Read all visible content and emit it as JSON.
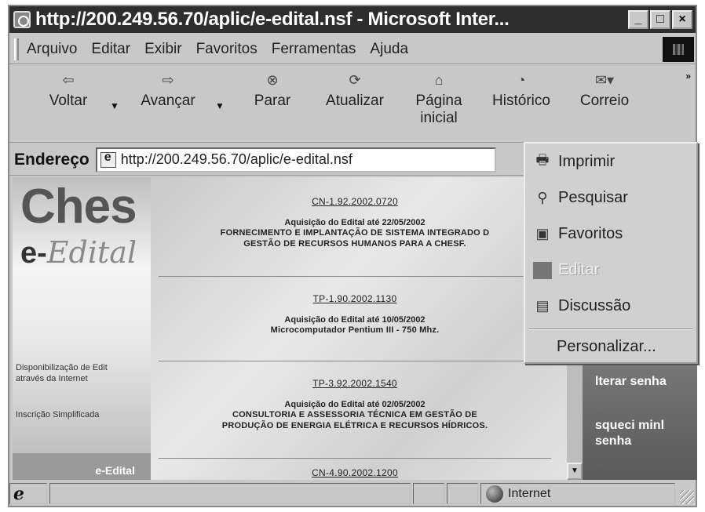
{
  "window": {
    "title": "http://200.249.56.70/aplic/e-edital.nsf - Microsoft Inter...",
    "minimize": "_",
    "maximize": "□",
    "close": "×"
  },
  "menubar": {
    "items": [
      "Arquivo",
      "Editar",
      "Exibir",
      "Favoritos",
      "Ferramentas",
      "Ajuda"
    ]
  },
  "toolbar": {
    "back": "Voltar",
    "forward": "Avançar",
    "stop": "Parar",
    "refresh": "Atualizar",
    "home_line1": "Página",
    "home_line2": "inicial",
    "history": "Histórico",
    "mail": "Correio",
    "more": "»"
  },
  "addressbar": {
    "label": "Endereço",
    "url": "http://200.249.56.70/aplic/e-edital.nsf"
  },
  "page": {
    "logo_top": "Ches",
    "logo_e": "e-",
    "logo_edital": "Edital",
    "left_links": [
      "Disponibilização de Edit",
      "através da Internet",
      "Inscrição Simplificada"
    ],
    "left_bottom": "e-Edital",
    "editais": [
      {
        "code": "CN-1.92.2002.0720",
        "date": "Aquisição do Edital até 22/05/2002",
        "desc": [
          "FORNECIMENTO E IMPLANTAÇÃO DE SISTEMA INTEGRADO D",
          "GESTÃO DE RECURSOS HUMANOS PARA A CHESF."
        ]
      },
      {
        "code": "TP-1.90.2002.1130",
        "date": "Aquisição do Edital até 10/05/2002",
        "desc": [
          "Microcomputador Pentium III - 750 Mhz."
        ]
      },
      {
        "code": "TP-3.92.2002.1540",
        "date": "Aquisição do Edital até 02/05/2002",
        "desc": [
          "CONSULTORIA E ASSESSORIA TÉCNICA EM GESTÃO DE",
          "PRODUÇÃO DE ENERGIA ELÉTRICA E RECURSOS HÍDRICOS."
        ]
      },
      {
        "code": "CN-4.90.2002.1200",
        "date": "",
        "desc": []
      }
    ],
    "right_panel": {
      "alterar": "lterar senha",
      "esqueci_1": "squeci minl",
      "esqueci_2": "senha"
    }
  },
  "dropdown": {
    "items": [
      {
        "label": "Imprimir",
        "icon": "printer-icon"
      },
      {
        "label": "Pesquisar",
        "icon": "search-icon"
      },
      {
        "label": "Favoritos",
        "icon": "favorites-folder-icon"
      },
      {
        "label": "Editar",
        "icon": "edit-icon",
        "disabled": true
      },
      {
        "label": "Discussão",
        "icon": "discussion-icon"
      }
    ],
    "customize": "Personalizar..."
  },
  "statusbar": {
    "zone": "Internet"
  }
}
